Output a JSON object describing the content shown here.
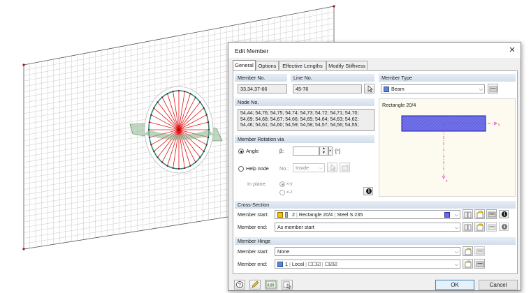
{
  "dialog": {
    "title": "Edit Member",
    "tabs": [
      "General",
      "Options",
      "Effective Lengths",
      "Modify Stiffness"
    ],
    "member_no": {
      "label": "Member No.",
      "value": "33,34,37-66"
    },
    "line_no": {
      "label": "Line No.",
      "value": "45-76"
    },
    "member_type": {
      "label": "Member Type",
      "value": "Beam",
      "color": "#5b86d6"
    },
    "node_no": {
      "label": "Node No.",
      "lines": [
        "54,44; 54,76; 54,75; 54,74; 54,73; 54,72; 54,71; 54,70;",
        "54,69; 54,68; 54,67; 54,66; 54,65; 54,64; 54,63; 54,62;",
        "54,46; 54,61; 54,60; 54,59; 54,58; 54,57; 54,56; 54,55;"
      ]
    },
    "preview": {
      "title": "Rectangle 20/4",
      "axis_y": "y",
      "axis_z": "z",
      "fill": "#6a6ae8"
    },
    "rotation": {
      "label": "Member Rotation via",
      "angle_label": "Angle",
      "beta_label": "β:",
      "beta_value": "",
      "unit": "[°]",
      "help_node_label": "Help node",
      "no_label": "No.:",
      "no_value": "Inside",
      "in_plane_label": "In plane:",
      "plane_xy": "x-y",
      "plane_xz": "x-z",
      "selected": "angle"
    },
    "cross_section": {
      "label": "Cross-Section",
      "start_label": "Member start:",
      "start_num": "2",
      "start_name": "Rectangle 20/4",
      "start_material": "Steel S 235",
      "start_color": "#f2c500",
      "start_marker_color": "#6a6ae8",
      "end_label": "Member end:",
      "end_value": "As member start"
    },
    "hinge": {
      "label": "Member Hinge",
      "start_label": "Member start:",
      "start_value": "None",
      "end_label": "Member end:",
      "end_num": "1",
      "end_local": "Local",
      "end_color": "#5b86d6"
    },
    "buttons": {
      "ok": "OK",
      "cancel": "Cancel"
    },
    "footer_zero": "0,00"
  }
}
